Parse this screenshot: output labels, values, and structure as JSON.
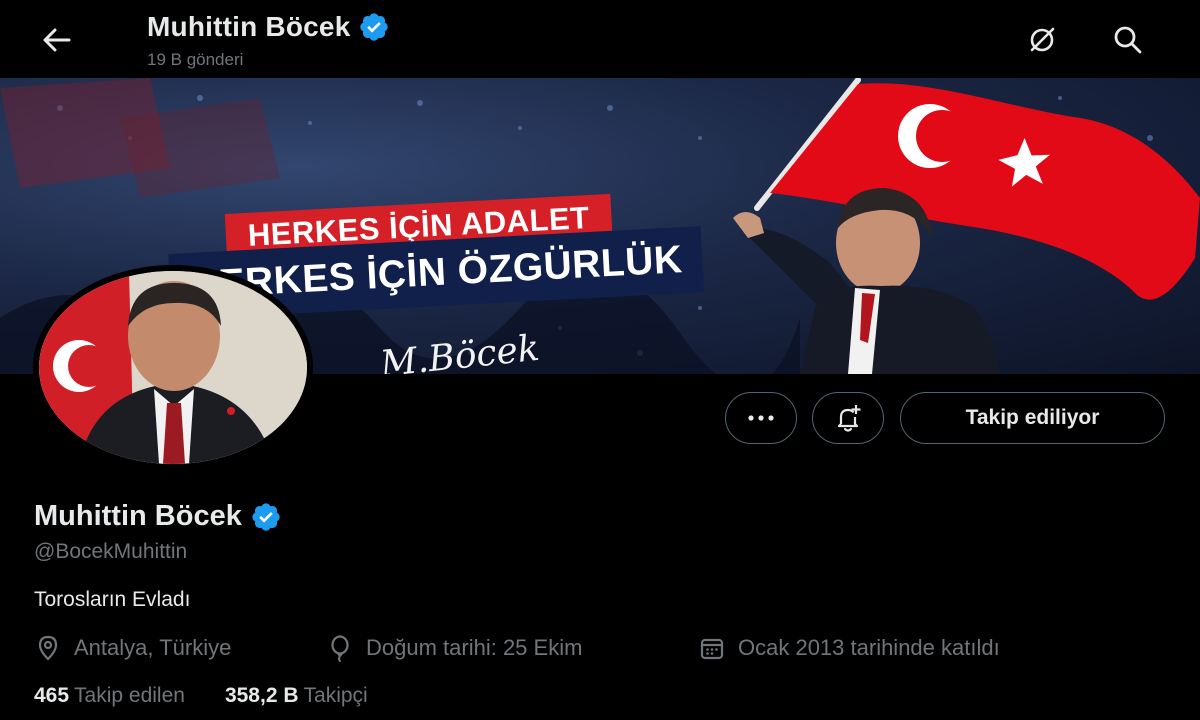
{
  "header": {
    "name": "Muhittin Böcek",
    "post_count": "19 B gönderi",
    "verified_icon": "verified-badge-icon",
    "back_icon": "back-arrow-icon",
    "lock_icon": "circle-slash-icon",
    "search_icon": "search-icon"
  },
  "banner": {
    "slogan_line1": "HERKES İÇİN ADALET",
    "slogan_line2": "HERKES İÇİN ÖZGÜRLÜK",
    "signature": "M.Böcek"
  },
  "actions": {
    "more_icon": "more-dots-icon",
    "notify_icon": "bell-plus-icon",
    "follow_label": "Takip ediliyor"
  },
  "profile": {
    "name": "Muhittin Böcek",
    "handle": "@BocekMuhittin",
    "bio": "Torosların Evladı",
    "location": "Antalya, Türkiye",
    "birthday": "Doğum tarihi: 25 Ekim",
    "joined": "Ocak 2013 tarihinde katıldı",
    "following_count": "465",
    "following_label": "Takip edilen",
    "followers_count": "358,2 B",
    "followers_label": "Takipçi"
  },
  "colors": {
    "background": "#000000",
    "text": "#e7e9ea",
    "muted": "#71767b",
    "verified": "#1d9bf0",
    "flag_red": "#e30a17",
    "slogan_red": "#d62027",
    "slogan_navy": "#10204a"
  }
}
